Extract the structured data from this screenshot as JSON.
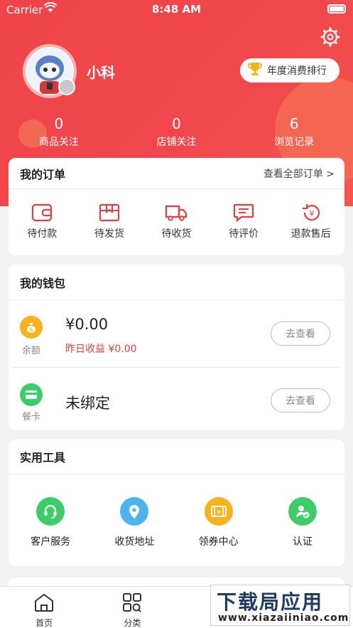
{
  "status_bar": {
    "carrier": "Carrier",
    "time": "8:48 AM"
  },
  "profile": {
    "username": "小科",
    "rank_button": "年度消费排行"
  },
  "stats": [
    {
      "value": "0",
      "label": "商品关注"
    },
    {
      "value": "0",
      "label": "店铺关注"
    },
    {
      "value": "6",
      "label": "浏览记录"
    }
  ],
  "orders": {
    "title": "我的订单",
    "view_all": "查看全部订单 >",
    "items": [
      {
        "label": "待付款",
        "icon": "wallet-icon"
      },
      {
        "label": "待发货",
        "icon": "package-icon"
      },
      {
        "label": "待收货",
        "icon": "truck-icon"
      },
      {
        "label": "待评价",
        "icon": "comment-icon"
      },
      {
        "label": "退款售后",
        "icon": "refund-icon"
      }
    ]
  },
  "wallet": {
    "title": "我的钱包",
    "balance": {
      "icon_label": "余额",
      "amount": "¥0.00",
      "yesterday": "昨日收益 ¥0.00",
      "button": "去查看"
    },
    "meal_card": {
      "icon_label": "餐卡",
      "status": "未绑定",
      "button": "去查看"
    }
  },
  "tools": {
    "title": "实用工具",
    "items": [
      {
        "label": "客户服务",
        "icon": "headset-icon",
        "color": "#3ecb6a"
      },
      {
        "label": "收货地址",
        "icon": "location-icon",
        "color": "#4fb2f0"
      },
      {
        "label": "领券中心",
        "icon": "coupon-icon",
        "color": "#f7b21c"
      },
      {
        "label": "认证",
        "icon": "verified-user-icon",
        "color": "#3ecb6a"
      }
    ]
  },
  "tabbar": [
    {
      "label": "首页",
      "icon": "home-icon"
    },
    {
      "label": "分类",
      "icon": "category-icon"
    }
  ],
  "watermark": {
    "line1": "下载局应用",
    "line2": "www.xiazaiiniao.com"
  },
  "colors": {
    "brand": "#ef4448",
    "accent_red": "#e33d41",
    "green": "#3ecb6a",
    "blue": "#4fb2f0",
    "gold": "#f7b21c"
  }
}
